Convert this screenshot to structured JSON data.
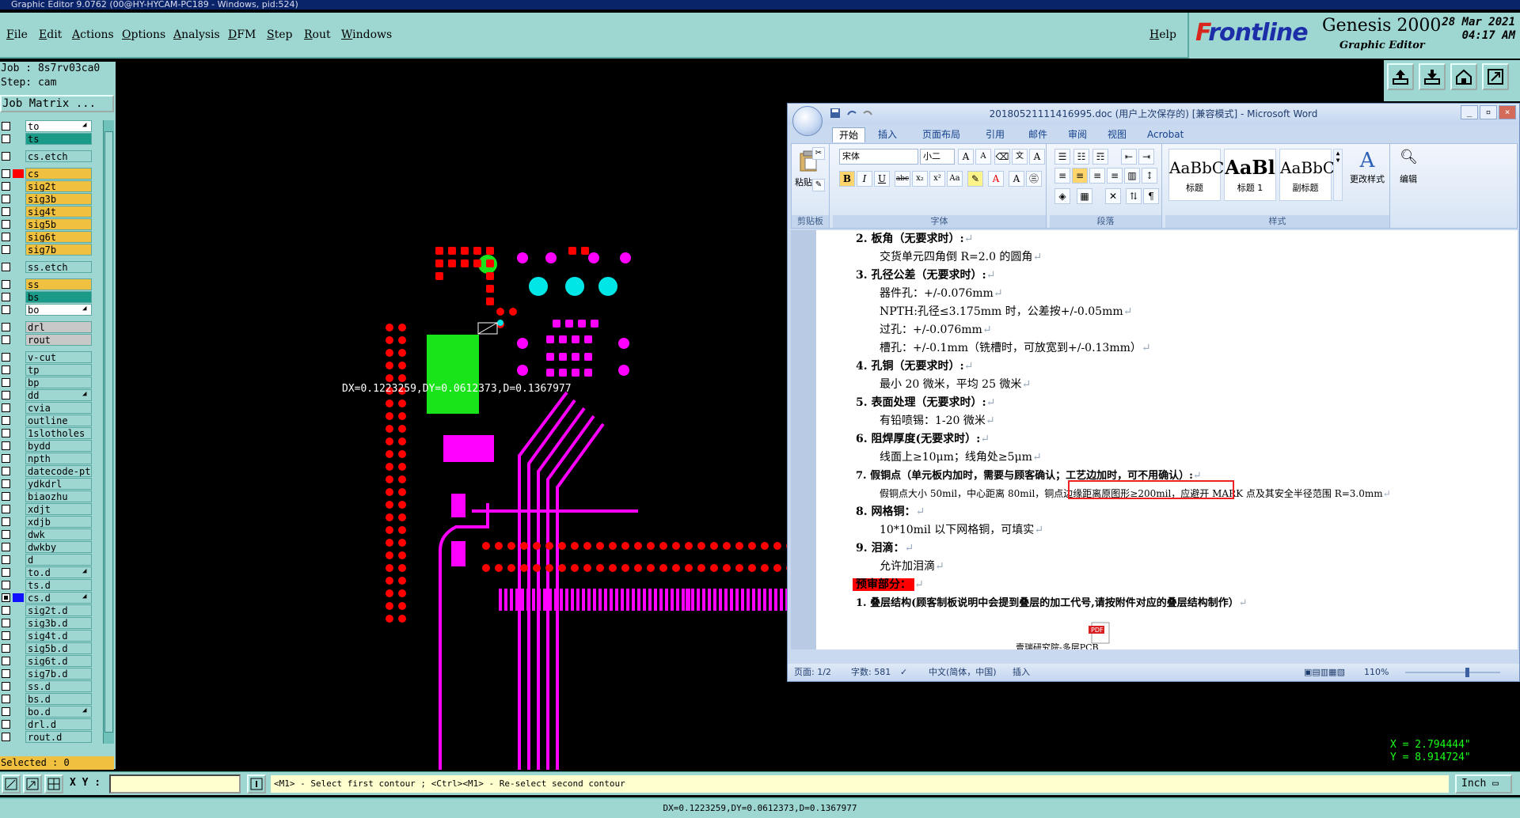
{
  "titlebar": {
    "text": "Graphic Editor 9.0762 (00@HY-HYCAM-PC189 - Windows, pid:524)"
  },
  "menu": {
    "items": [
      "File",
      "Edit",
      "Actions",
      "Options",
      "Analysis",
      "DFM",
      "Step",
      "Rout",
      "Windows"
    ],
    "help": "Help"
  },
  "brand": {
    "logo_part1": "F",
    "logo_part2": "rontline",
    "product": "Genesis 2000",
    "subtitle": "Graphic Editor",
    "date": "28 Mar 2021",
    "time": "04:17 AM"
  },
  "job": {
    "job_line": "Job : 8s7rv03ca0",
    "step_line": "Step: cam",
    "matrix_label": "Job Matrix ..."
  },
  "layers": [
    {
      "name": "to",
      "color": "#ffffff",
      "swatch": "",
      "checked": false,
      "arrow": true
    },
    {
      "name": "ts",
      "color": "#1a9a88",
      "swatch": "",
      "checked": false,
      "arrow": false
    },
    {
      "name": "cs.etch",
      "color": "#9ed7d2",
      "swatch": "",
      "checked": false,
      "arrow": false,
      "gap": true
    },
    {
      "name": "cs",
      "color": "#f0c040",
      "swatch": "#ff0000",
      "checked": false,
      "arrow": false,
      "gap": true
    },
    {
      "name": "sig2t",
      "color": "#f0c040",
      "swatch": "",
      "checked": false,
      "arrow": false
    },
    {
      "name": "sig3b",
      "color": "#f0c040",
      "swatch": "",
      "checked": false,
      "arrow": false
    },
    {
      "name": "sig4t",
      "color": "#f0c040",
      "swatch": "",
      "checked": false,
      "arrow": false
    },
    {
      "name": "sig5b",
      "color": "#f0c040",
      "swatch": "",
      "checked": false,
      "arrow": false
    },
    {
      "name": "sig6t",
      "color": "#f0c040",
      "swatch": "",
      "checked": false,
      "arrow": false
    },
    {
      "name": "sig7b",
      "color": "#f0c040",
      "swatch": "",
      "checked": false,
      "arrow": false
    },
    {
      "name": "ss.etch",
      "color": "#9ed7d2",
      "swatch": "",
      "checked": false,
      "arrow": false,
      "gap": true
    },
    {
      "name": "ss",
      "color": "#f0c040",
      "swatch": "",
      "checked": false,
      "arrow": false,
      "gap": true
    },
    {
      "name": "bs",
      "color": "#1a9a88",
      "swatch": "",
      "checked": false,
      "arrow": false
    },
    {
      "name": "bo",
      "color": "#ffffff",
      "swatch": "",
      "checked": false,
      "arrow": true
    },
    {
      "name": "drl",
      "color": "#c8c8c8",
      "swatch": "",
      "checked": false,
      "arrow": false,
      "gap": true
    },
    {
      "name": "rout",
      "color": "#c8c8c8",
      "swatch": "",
      "checked": false,
      "arrow": false
    },
    {
      "name": "v-cut",
      "color": "#9ed7d2",
      "swatch": "",
      "checked": false,
      "arrow": false,
      "gap": true
    },
    {
      "name": "tp",
      "color": "#9ed7d2",
      "swatch": "",
      "checked": false,
      "arrow": false
    },
    {
      "name": "bp",
      "color": "#9ed7d2",
      "swatch": "",
      "checked": false,
      "arrow": false
    },
    {
      "name": "dd",
      "color": "#9ed7d2",
      "swatch": "",
      "checked": false,
      "arrow": true
    },
    {
      "name": "cvia",
      "color": "#9ed7d2",
      "swatch": "",
      "checked": false,
      "arrow": false
    },
    {
      "name": "outline",
      "color": "#9ed7d2",
      "swatch": "",
      "checked": false,
      "arrow": false
    },
    {
      "name": "1slotholes",
      "color": "#9ed7d2",
      "swatch": "",
      "checked": false,
      "arrow": false
    },
    {
      "name": "bydd",
      "color": "#9ed7d2",
      "swatch": "",
      "checked": false,
      "arrow": false
    },
    {
      "name": "npth",
      "color": "#9ed7d2",
      "swatch": "",
      "checked": false,
      "arrow": false
    },
    {
      "name": "datecode-pth",
      "color": "#9ed7d2",
      "swatch": "",
      "checked": false,
      "arrow": false
    },
    {
      "name": "ydkdrl",
      "color": "#9ed7d2",
      "swatch": "",
      "checked": false,
      "arrow": false
    },
    {
      "name": "biaozhu",
      "color": "#9ed7d2",
      "swatch": "",
      "checked": false,
      "arrow": false
    },
    {
      "name": "xdjt",
      "color": "#9ed7d2",
      "swatch": "",
      "checked": false,
      "arrow": false
    },
    {
      "name": "xdjb",
      "color": "#9ed7d2",
      "swatch": "",
      "checked": false,
      "arrow": false
    },
    {
      "name": "dwk",
      "color": "#9ed7d2",
      "swatch": "",
      "checked": false,
      "arrow": false
    },
    {
      "name": "dwkby",
      "color": "#9ed7d2",
      "swatch": "",
      "checked": false,
      "arrow": false
    },
    {
      "name": "d",
      "color": "#9ed7d2",
      "swatch": "",
      "checked": false,
      "arrow": false
    },
    {
      "name": "to.d",
      "color": "#9ed7d2",
      "swatch": "",
      "checked": false,
      "arrow": true
    },
    {
      "name": "ts.d",
      "color": "#9ed7d2",
      "swatch": "",
      "checked": false,
      "arrow": false
    },
    {
      "name": "cs.d",
      "color": "#9ed7d2",
      "swatch": "#1010ff",
      "checked": true,
      "arrow": true
    },
    {
      "name": "sig2t.d",
      "color": "#9ed7d2",
      "swatch": "",
      "checked": false,
      "arrow": false
    },
    {
      "name": "sig3b.d",
      "color": "#9ed7d2",
      "swatch": "",
      "checked": false,
      "arrow": false
    },
    {
      "name": "sig4t.d",
      "color": "#9ed7d2",
      "swatch": "",
      "checked": false,
      "arrow": false
    },
    {
      "name": "sig5b.d",
      "color": "#9ed7d2",
      "swatch": "",
      "checked": false,
      "arrow": false
    },
    {
      "name": "sig6t.d",
      "color": "#9ed7d2",
      "swatch": "",
      "checked": false,
      "arrow": false
    },
    {
      "name": "sig7b.d",
      "color": "#9ed7d2",
      "swatch": "",
      "checked": false,
      "arrow": false
    },
    {
      "name": "ss.d",
      "color": "#9ed7d2",
      "swatch": "",
      "checked": false,
      "arrow": false
    },
    {
      "name": "bs.d",
      "color": "#9ed7d2",
      "swatch": "",
      "checked": false,
      "arrow": false
    },
    {
      "name": "bo.d",
      "color": "#9ed7d2",
      "swatch": "",
      "checked": false,
      "arrow": true
    },
    {
      "name": "drl.d",
      "color": "#9ed7d2",
      "swatch": "",
      "checked": false,
      "arrow": false
    },
    {
      "name": "rout.d",
      "color": "#9ed7d2",
      "swatch": "",
      "checked": false,
      "arrow": false
    }
  ],
  "selected": "Selected : 0",
  "measurement": "DX=0.1223259,DY=0.0612373,D=0.1367977",
  "coords": {
    "x": "X = 2.794444\"",
    "y": "Y = 8.914724\""
  },
  "cmd": {
    "xy_label": "X Y :",
    "xy_value": "",
    "prompt": "<M1> - Select first contour ; <Ctrl><M1> - Re-select second contour",
    "units": "Inch"
  },
  "status": "DX=0.1223259,DY=0.0612373,D=0.1367977",
  "word": {
    "title": "20180521111416995.doc (用户上次保存的) [兼容模式] - Microsoft Word",
    "tabs": [
      "开始",
      "插入",
      "页面布局",
      "引用",
      "邮件",
      "审阅",
      "视图",
      "Acrobat"
    ],
    "clipboard": {
      "paste": "粘贴",
      "label": "剪贴板"
    },
    "font": {
      "name": "宋体",
      "size": "小二",
      "label": "字体"
    },
    "paragraph_label": "段落",
    "styles": [
      {
        "preview": "AaBbC",
        "name": "标题"
      },
      {
        "preview": "AaBl",
        "name": "标题 1"
      },
      {
        "preview": "AaBbC",
        "name": "副标题"
      }
    ],
    "styles_label": "样式",
    "change_styles": "更改样式",
    "edit": "编辑",
    "doc": {
      "l1": "2. 板角（无要求时）:",
      "l2": "交货单元四角倒 R=2.0 的圆角",
      "l3": "3. 孔径公差（无要求时）:",
      "l4": "器件孔：+/-0.076mm",
      "l5": "NPTH:孔径≤3.175mm 时，公差按+/-0.05mm",
      "l6": "过孔：+/-0.076mm",
      "l7": "槽孔：+/-0.1mm（铣槽时，可放宽到+/-0.13mm）",
      "l8": "4. 孔铜（无要求时）:",
      "l9": "最小 20 微米，平均 25 微米",
      "l10": "5. 表面处理（无要求时）:",
      "l11": "有铅喷锡：1-20 微米",
      "l12": "6. 阻焊厚度(无要求时）:",
      "l13": "线面上≥10μm；线角处≥5μm",
      "l14": "7. 假铜点（单元板内加时，需要与顾客确认；工艺边加时，可不用确认）:",
      "l15a": "假铜点大小 50mil，中心距离 80mil，",
      "l15b": "铜点边缘距离原图形≥200mil",
      "l15c": "，应避开 MARK 点及其安全半径范围 R=3.0mm",
      "l16": "8. 网格铜：",
      "l17": "10*10mil 以下网格铜，可填实",
      "l18": "9. 泪滴：",
      "l19": "允许加泪滴",
      "l20": "预审部分：",
      "l21": "1. 叠层结构(顾客制板说明中会提到叠层的加工代号,请按附件对应的叠层结构制作）",
      "pdf_label": "壹瑞研究院-多层PCB"
    },
    "status": {
      "page": "页面: 1/2",
      "words": "字数: 581",
      "lang": "中文(简体，中国)",
      "mode": "插入",
      "zoom": "110%"
    }
  }
}
